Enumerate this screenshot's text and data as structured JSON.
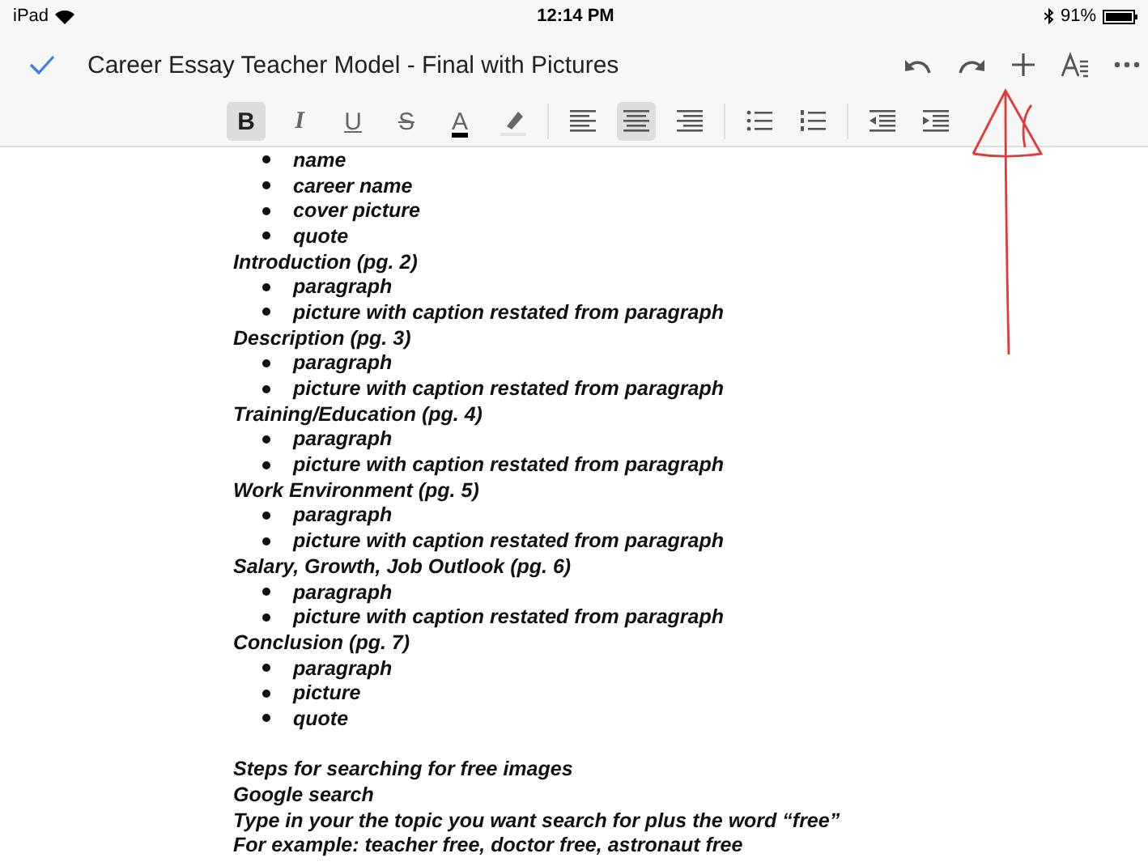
{
  "status_bar": {
    "device": "iPad",
    "time": "12:14 PM",
    "battery": "91%"
  },
  "header": {
    "title": "Career Essay Teacher Model - Final with Pictures"
  },
  "toolbar": [
    {
      "kind": "text",
      "label": "B",
      "selected": true
    },
    {
      "kind": "text",
      "label": "I",
      "selected": false
    },
    {
      "kind": "text",
      "label": "U",
      "selected": false
    },
    {
      "kind": "text",
      "label": "S",
      "selected": false
    },
    {
      "kind": "text",
      "label": "A",
      "selected": false
    },
    {
      "kind": "highlighter",
      "selected": false
    },
    {
      "kind": "separator"
    },
    {
      "kind": "align-left",
      "selected": false
    },
    {
      "kind": "align-center",
      "selected": true
    },
    {
      "kind": "align-right",
      "selected": false
    },
    {
      "kind": "separator"
    },
    {
      "kind": "bullets",
      "selected": false
    },
    {
      "kind": "numbers",
      "selected": false
    },
    {
      "kind": "separator"
    },
    {
      "kind": "outdent",
      "selected": false
    },
    {
      "kind": "indent",
      "selected": false
    }
  ],
  "document": [
    {
      "kind": "bullet",
      "text": "name"
    },
    {
      "kind": "bullet",
      "text": "career name"
    },
    {
      "kind": "bullet",
      "text": "cover picture"
    },
    {
      "kind": "bullet",
      "text": "quote"
    },
    {
      "kind": "heading",
      "text": "Introduction (pg. 2)"
    },
    {
      "kind": "bullet",
      "text": "paragraph"
    },
    {
      "kind": "bullet",
      "text": "picture with caption restated from paragraph"
    },
    {
      "kind": "heading",
      "text": "Description (pg. 3)"
    },
    {
      "kind": "bullet",
      "text": "paragraph"
    },
    {
      "kind": "bullet",
      "text": "picture with caption restated from paragraph"
    },
    {
      "kind": "heading",
      "text": "Training/Education (pg. 4)"
    },
    {
      "kind": "bullet",
      "text": "paragraph"
    },
    {
      "kind": "bullet",
      "text": "picture with caption restated from paragraph"
    },
    {
      "kind": "heading",
      "text": "Work Environment (pg. 5)"
    },
    {
      "kind": "bullet",
      "text": "paragraph"
    },
    {
      "kind": "bullet",
      "text": "picture with caption restated from paragraph"
    },
    {
      "kind": "heading",
      "text": "Salary, Growth, Job Outlook (pg. 6)"
    },
    {
      "kind": "bullet",
      "text": "paragraph"
    },
    {
      "kind": "bullet",
      "text": "picture with caption restated from paragraph"
    },
    {
      "kind": "heading",
      "text": "Conclusion (pg. 7)"
    },
    {
      "kind": "bullet",
      "text": "paragraph"
    },
    {
      "kind": "bullet",
      "text": "picture"
    },
    {
      "kind": "bullet",
      "text": "quote"
    },
    {
      "kind": "blank"
    },
    {
      "kind": "heading",
      "text": "Steps for searching for free images"
    },
    {
      "kind": "heading",
      "text": "Google search"
    },
    {
      "kind": "heading",
      "text": "Type in your the topic you want search for plus the word “free”"
    },
    {
      "kind": "heading",
      "text": "For example: teacher free, doctor free, astronaut free"
    }
  ]
}
